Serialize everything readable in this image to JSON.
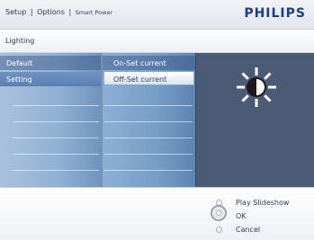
{
  "header": {
    "crumb_setup": "Setup",
    "crumb_options": "Options",
    "crumb_current": "Smart Power",
    "separator": "|",
    "brand": "PHILIPS"
  },
  "subheader": {
    "title": "Lighting"
  },
  "menu": {
    "level1": [
      {
        "label": "Default"
      },
      {
        "label": "Setting"
      }
    ],
    "level2": [
      {
        "label": "On-Set current"
      },
      {
        "label": "Off-Set current"
      }
    ]
  },
  "preview": {
    "icon": "brightness-icon"
  },
  "actions": {
    "play_slideshow": "Play Slideshow",
    "ok": "OK",
    "cancel": "Cancel"
  },
  "colors": {
    "brand": "#1b3f87",
    "panel_dark": "#4c5b75",
    "selection": "#5a7fb1"
  }
}
